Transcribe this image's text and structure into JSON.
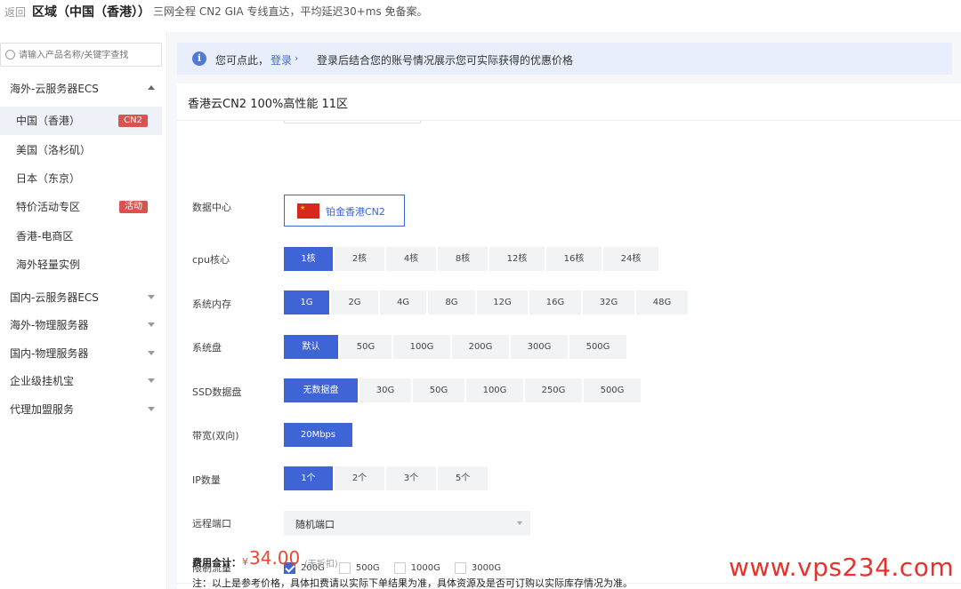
{
  "header": {
    "back_label": "返回",
    "region_title": "区域（中国（香港））",
    "description": "三网全程 CN2 GIA 专线直达，平均延迟30+ms 免备案。"
  },
  "sidebar": {
    "search_placeholder": "请输入产品名称/关键字查找",
    "groups": [
      {
        "label": "海外-云服务器ECS",
        "expanded": true,
        "items": [
          {
            "label": "中国（香港）",
            "tag": "CN2",
            "active": true
          },
          {
            "label": "美国（洛杉矶）"
          },
          {
            "label": "日本（东京）"
          },
          {
            "label": "特价活动专区",
            "tag": "活动"
          },
          {
            "label": "香港-电商区"
          },
          {
            "label": "海外轻量实例"
          }
        ]
      },
      {
        "label": "国内-云服务器ECS"
      },
      {
        "label": "海外-物理服务器"
      },
      {
        "label": "国内-物理服务器"
      },
      {
        "label": "企业级挂机宝"
      },
      {
        "label": "代理加盟服务"
      }
    ]
  },
  "notice": {
    "prefix": "您可点此，",
    "login_link": "登录",
    "chevron": "›",
    "text": "登录后结合您的账号情况展示您可实际获得的优惠价格"
  },
  "product": {
    "title": "香港云CN2 100%高性能 11区",
    "datacenter": {
      "label": "数据中心",
      "value": "铂金香港CN2",
      "flag_glyph": "★"
    },
    "cpu": {
      "label": "cpu核心",
      "options": [
        "1核",
        "2核",
        "4核",
        "8核",
        "12核",
        "16核",
        "24核"
      ],
      "selected": "1核"
    },
    "memory": {
      "label": "系统内存",
      "options": [
        "1G",
        "2G",
        "4G",
        "8G",
        "12G",
        "16G",
        "32G",
        "48G"
      ],
      "selected": "1G"
    },
    "system_disk": {
      "label": "系统盘",
      "options": [
        "默认",
        "50G",
        "100G",
        "200G",
        "300G",
        "500G"
      ],
      "selected": "默认"
    },
    "ssd_disk": {
      "label": "SSD数据盘",
      "options": [
        "无数据盘",
        "30G",
        "50G",
        "100G",
        "250G",
        "500G"
      ],
      "selected": "无数据盘"
    },
    "bandwidth": {
      "label": "带宽(双向)",
      "options": [
        "20Mbps"
      ],
      "selected": "20Mbps"
    },
    "ip_count": {
      "label": "IP数量",
      "options": [
        "1个",
        "2个",
        "3个",
        "5个"
      ],
      "selected": "1个"
    },
    "remote_port": {
      "label": "远程端口",
      "value": "随机端口"
    },
    "traffic_limit": {
      "label": "限制流量",
      "options": [
        "200G",
        "500G",
        "1000G",
        "3000G"
      ],
      "checked": "200G"
    }
  },
  "fee": {
    "label": "费用合计：",
    "currency": "¥",
    "price": "34.00",
    "discount_note": "(无折扣)",
    "note": "注：以上是参考价格，具体扣费请以实际下单结果为准，具体资源及是否可订购以实际库存情况为准。"
  },
  "watermark": "www.vps234.com",
  "colors": {
    "accent": "#3e64d6",
    "price": "#e8492f",
    "tag": "#d9534f",
    "watermark": "#e8312a"
  }
}
